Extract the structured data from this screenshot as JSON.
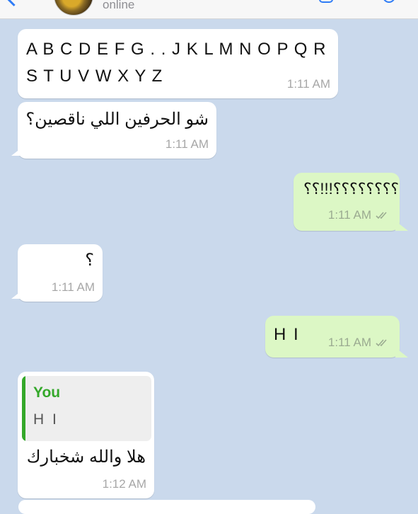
{
  "header": {
    "status": "online"
  },
  "messages": [
    {
      "id": "m1",
      "direction": "in",
      "text": "A B C D E F G . . J K L M N O P Q R\nS T U V W X Y Z",
      "time": "1:11 AM"
    },
    {
      "id": "m2",
      "direction": "in",
      "text": "شو الحرفين اللي ناقصين؟",
      "time": "1:11 AM"
    },
    {
      "id": "m3",
      "direction": "out",
      "text": "؟؟؟؟؟؟؟؟!!!؟؟",
      "time": "1:11 AM",
      "read": true
    },
    {
      "id": "m4",
      "direction": "in",
      "text": "؟",
      "time": "1:11 AM"
    },
    {
      "id": "m5",
      "direction": "out",
      "text": "H I",
      "time": "1:11 AM",
      "read": true
    },
    {
      "id": "m6",
      "direction": "in",
      "text": "هلا والله شخبارك",
      "time": "1:12 AM",
      "quote": {
        "author": "You",
        "text": "H I"
      }
    }
  ],
  "colors": {
    "background": "#cad9ec",
    "incoming": "#ffffff",
    "outgoing": "#dcf7c5",
    "accent": "#2f7cf6",
    "quote_accent": "#34a82a",
    "read_ticks": "#9bab91"
  },
  "icons": [
    "back-chevron-icon",
    "video-call-icon",
    "phone-call-icon",
    "double-check-icon"
  ]
}
